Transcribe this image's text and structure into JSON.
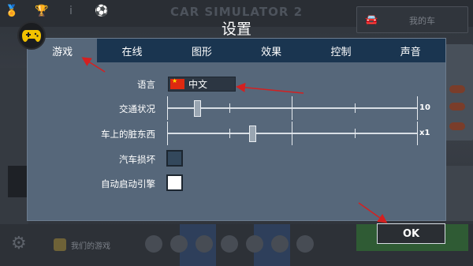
{
  "background": {
    "title": "CAR SIMULATOR 2",
    "top_left_icons": [
      "medal-icon",
      "trophy-icon",
      "info-icon",
      "soccer-icon"
    ],
    "my_car_label": "我的车",
    "my_games_label": "我们的游戏"
  },
  "dialog": {
    "title": "设置",
    "tabs": [
      {
        "label": "游戏",
        "active": true
      },
      {
        "label": "在线",
        "active": false
      },
      {
        "label": "图形",
        "active": false
      },
      {
        "label": "效果",
        "active": false
      },
      {
        "label": "控制",
        "active": false
      },
      {
        "label": "声音",
        "active": false
      }
    ],
    "language": {
      "label": "语言",
      "value": "中文",
      "flag": "china-flag-icon"
    },
    "traffic": {
      "label": "交通状况",
      "value_text": "10",
      "level": 0.12
    },
    "dirt": {
      "label": "车上的脏东西",
      "value_text": "x1",
      "level": 0.34
    },
    "car_damage": {
      "label": "汽车损坏",
      "checked": false
    },
    "auto_start": {
      "label": "自动启动引擎",
      "checked": true
    },
    "ok_label": "OK"
  },
  "colors": {
    "dialog_bg": "#56677a",
    "tab_bar": "#1a3550",
    "annotation_arrow": "#d42020"
  }
}
